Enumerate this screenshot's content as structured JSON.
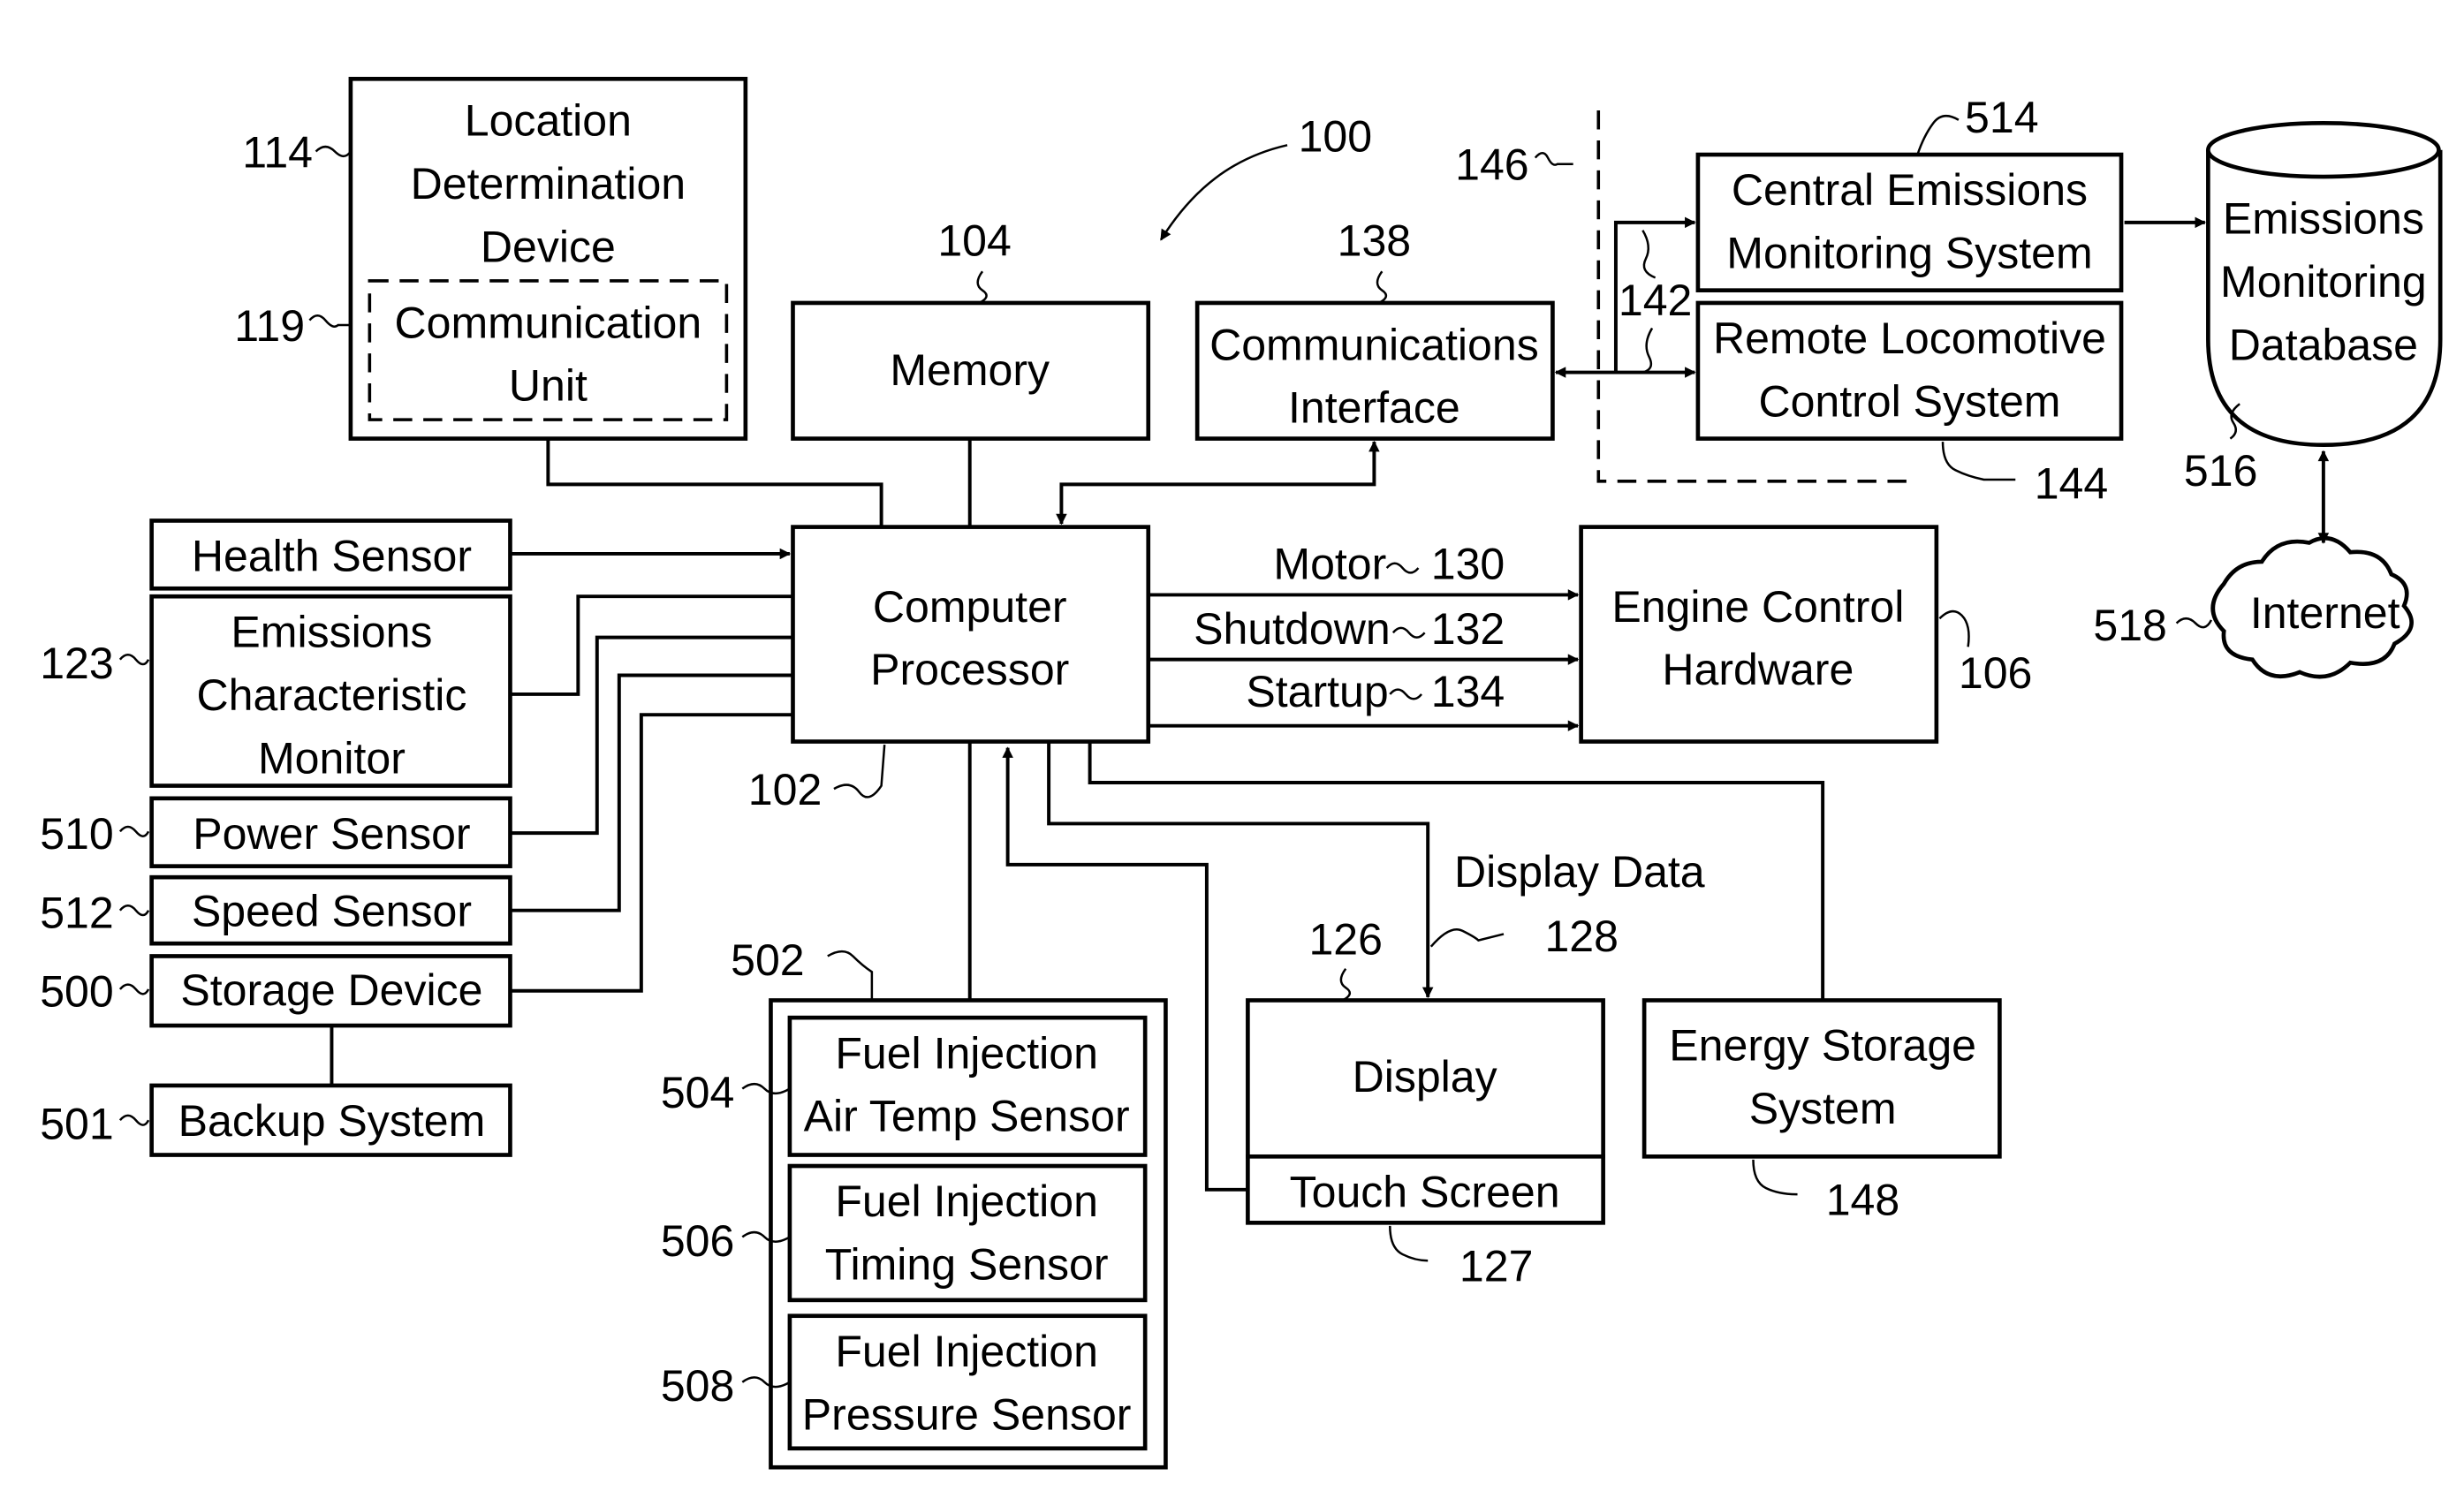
{
  "figure": {
    "ref": "100",
    "nodes": {
      "location_device": {
        "ref": "114",
        "lines": [
          "Location",
          "Determination",
          "Device"
        ]
      },
      "communication_unit": {
        "ref": "119",
        "lines": [
          "Communication",
          "Unit"
        ]
      },
      "memory": {
        "ref": "104",
        "lines": [
          "Memory"
        ]
      },
      "comm_interface": {
        "ref": "138",
        "lines": [
          "Communications",
          "Interface"
        ]
      },
      "boundary": {
        "ref": "146"
      },
      "links": {
        "ref": "142"
      },
      "central_emissions": {
        "ref": "514",
        "lines": [
          "Central Emissions",
          "Monitoring System"
        ]
      },
      "remote_locomotive": {
        "ref": "144",
        "lines": [
          "Remote Locomotive",
          "Control System"
        ]
      },
      "emissions_db": {
        "ref": "516",
        "lines": [
          "Emissions",
          "Monitoring",
          "Database"
        ]
      },
      "internet": {
        "ref": "518",
        "lines": [
          "Internet"
        ]
      },
      "health_sensor": {
        "lines": [
          "Health Sensor"
        ]
      },
      "emissions_monitor": {
        "ref": "123",
        "lines": [
          "Emissions",
          "Characteristic",
          "Monitor"
        ]
      },
      "power_sensor": {
        "ref": "510",
        "lines": [
          "Power Sensor"
        ]
      },
      "speed_sensor": {
        "ref": "512",
        "lines": [
          "Speed Sensor"
        ]
      },
      "storage_device": {
        "ref": "500",
        "lines": [
          "Storage Device"
        ]
      },
      "backup_system": {
        "ref": "501",
        "lines": [
          "Backup System"
        ]
      },
      "processor": {
        "ref": "102",
        "lines": [
          "Computer",
          "Processor"
        ]
      },
      "engine_control": {
        "ref": "106",
        "lines": [
          "Engine Control",
          "Hardware"
        ]
      },
      "fuel_group": {
        "ref": "502"
      },
      "fuel_air_temp": {
        "ref": "504",
        "lines": [
          "Fuel Injection",
          "Air Temp Sensor"
        ]
      },
      "fuel_timing": {
        "ref": "506",
        "lines": [
          "Fuel Injection",
          "Timing Sensor"
        ]
      },
      "fuel_pressure": {
        "ref": "508",
        "lines": [
          "Fuel Injection",
          "Pressure Sensor"
        ]
      },
      "display": {
        "ref": "126",
        "lines": [
          "Display"
        ]
      },
      "touch_screen": {
        "ref": "127",
        "lines": [
          "Touch Screen"
        ]
      },
      "energy_storage": {
        "ref": "148",
        "lines": [
          "Energy Storage",
          "System"
        ]
      }
    },
    "signals": {
      "motor": {
        "label": "Motor",
        "ref": "130"
      },
      "shutdown": {
        "label": "Shutdown",
        "ref": "132"
      },
      "startup": {
        "label": "Startup",
        "ref": "134"
      },
      "display_data": {
        "label": "Display Data",
        "ref": "128"
      }
    }
  }
}
